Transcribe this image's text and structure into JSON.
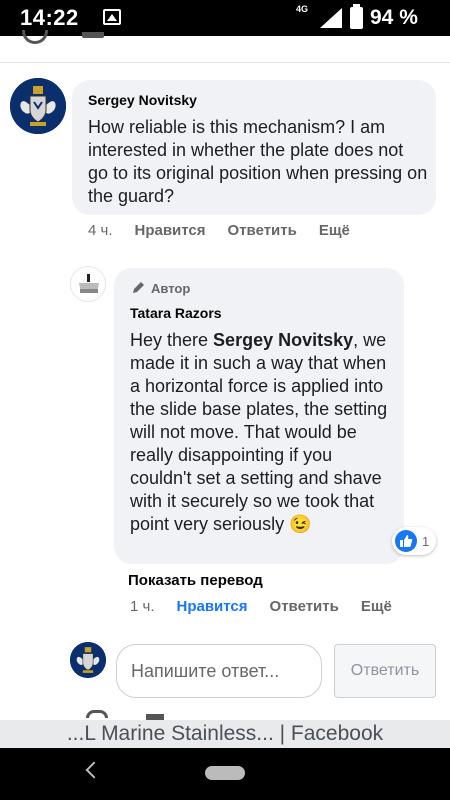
{
  "status_bar": {
    "time": "14:22",
    "network": "4G",
    "battery_pct": "94 %"
  },
  "comments": [
    {
      "author": "Sergey Novitsky",
      "text": "How reliable is this mechanism? I am interested in whether the plate does not go to its original position when pressing on the guard?",
      "time": "4 ч.",
      "like_label": "Нравится",
      "reply_label": "Ответить",
      "more_label": "Ещё"
    }
  ],
  "reply": {
    "badge_label": "Автор",
    "author": "Tatara Razors",
    "greeting": "Hey there ",
    "mention": "Sergey Novitsky",
    "text": ", we made it in such a way that when a horizontal force is applied into the slide base plates, the setting will not move. That would be really disappointing if you couldn't set a setting and shave with it securely so we took that point very seriously",
    "emoji": "😉",
    "reaction_count": "1",
    "show_translation": "Показать перевод",
    "time": "1 ч.",
    "like_label": "Нравится",
    "reply_label": "Ответить",
    "more_label": "Ещё"
  },
  "composer": {
    "placeholder": "Напишите ответ...",
    "send_label": "Ответить"
  },
  "page_title": "...L Marine Stainless... | Facebook",
  "colors": {
    "link_blue": "#1877f2",
    "bubble_bg": "#f0f2f5",
    "meta_grey": "#65676b"
  }
}
